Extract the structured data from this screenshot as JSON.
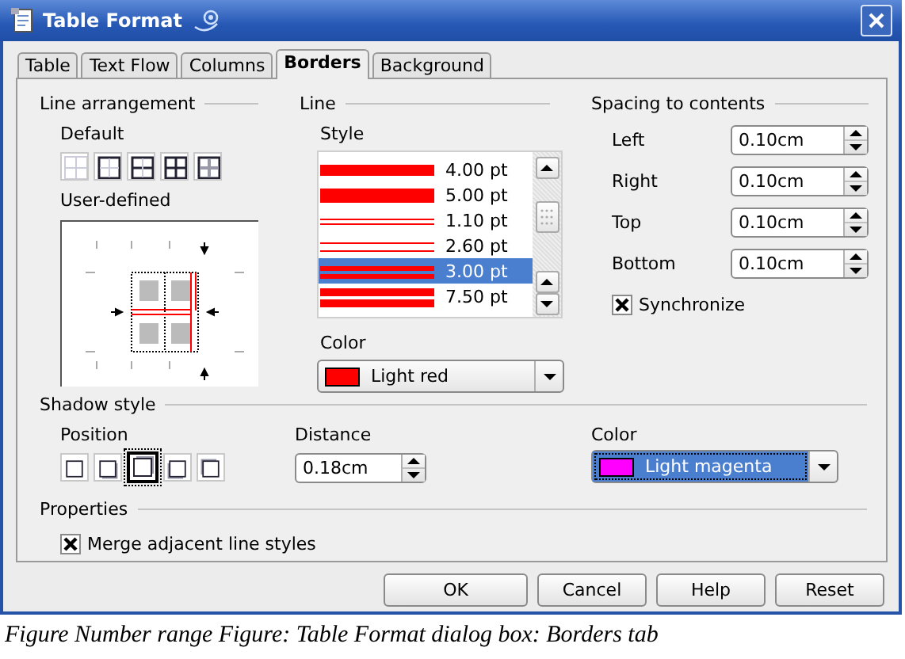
{
  "window": {
    "title": "Table Format"
  },
  "tabs": [
    {
      "label": "Table",
      "selected": false
    },
    {
      "label": "Text Flow",
      "selected": false
    },
    {
      "label": "Columns",
      "selected": false
    },
    {
      "label": "Borders",
      "selected": true
    },
    {
      "label": "Background",
      "selected": false
    }
  ],
  "line_arrangement": {
    "title": "Line arrangement",
    "default_label": "Default",
    "presets": [
      {
        "kind": "none"
      },
      {
        "kind": "box"
      },
      {
        "kind": "box-hline"
      },
      {
        "kind": "box-grid"
      },
      {
        "kind": "box-keep-inner"
      }
    ],
    "user_defined_label": "User-defined"
  },
  "line": {
    "title": "Line",
    "style_label": "Style",
    "styles": [
      {
        "kind": "single-thick",
        "label": "4.00 pt",
        "selected": false
      },
      {
        "kind": "single-heavy",
        "label": "5.00 pt",
        "selected": false
      },
      {
        "kind": "double-fine",
        "label": "1.10 pt",
        "selected": false
      },
      {
        "kind": "double-wide",
        "label": "2.60 pt",
        "selected": false
      },
      {
        "kind": "double-medium",
        "label": "3.00 pt",
        "selected": true
      },
      {
        "kind": "double-heavy",
        "label": "7.50 pt",
        "selected": false
      }
    ],
    "color_label": "Color",
    "color": {
      "name": "Light red",
      "color": "#ff0000"
    }
  },
  "spacing": {
    "title": "Spacing to contents",
    "fields": [
      {
        "label": "Left",
        "value": "0.10cm"
      },
      {
        "label": "Right",
        "value": "0.10cm"
      },
      {
        "label": "Top",
        "value": "0.10cm"
      },
      {
        "label": "Bottom",
        "value": "0.10cm"
      }
    ],
    "synchronize": {
      "label": "Synchronize",
      "checked": true
    }
  },
  "shadow": {
    "title": "Shadow style",
    "position_label": "Position",
    "positions": [
      {
        "kind": "none",
        "selected": false
      },
      {
        "kind": "bottom-right",
        "selected": false
      },
      {
        "kind": "top-right",
        "selected": true
      },
      {
        "kind": "bottom-left",
        "selected": false
      },
      {
        "kind": "top-left",
        "selected": false
      }
    ],
    "distance_label": "Distance",
    "distance": "0.18cm",
    "color_label": "Color",
    "color": {
      "name": "Light magenta",
      "color": "#ff00ff"
    }
  },
  "properties": {
    "title": "Properties",
    "merge": {
      "label": "Merge adjacent line styles",
      "checked": true
    }
  },
  "buttons": [
    "OK",
    "Cancel",
    "Help",
    "Reset"
  ],
  "caption": "Figure Number range Figure: Table Format dialog box: Borders tab"
}
